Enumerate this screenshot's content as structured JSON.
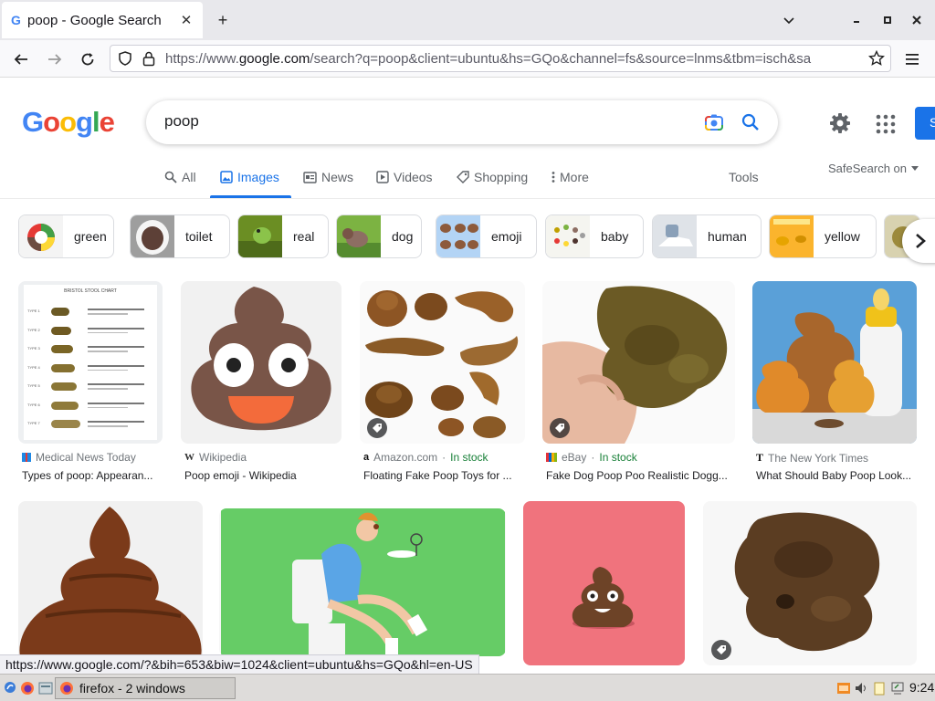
{
  "browser": {
    "tab_title": "poop - Google Search",
    "tab_favicon": "G",
    "new_tab": "+",
    "url_host_prefix": "https://www.",
    "url_host": "google.com",
    "url_path": "/search?q=poop&client=ubuntu&hs=GQo&channel=fs&source=lnms&tbm=isch&sa"
  },
  "search": {
    "query": "poop",
    "signin_label": "S"
  },
  "tabs": {
    "all": "All",
    "images": "Images",
    "news": "News",
    "videos": "Videos",
    "shopping": "Shopping",
    "more": "More",
    "tools": "Tools",
    "safesearch": "SafeSearch on"
  },
  "chips": [
    {
      "label": "green"
    },
    {
      "label": "toilet"
    },
    {
      "label": "real"
    },
    {
      "label": "dog"
    },
    {
      "label": "emoji"
    },
    {
      "label": "baby"
    },
    {
      "label": "human"
    },
    {
      "label": "yellow"
    }
  ],
  "results": [
    {
      "source": "Medical News Today",
      "stock": "",
      "caption": "Types of poop: Appearan..."
    },
    {
      "source": "Wikipedia",
      "stock": "",
      "caption": "Poop emoji - Wikipedia"
    },
    {
      "source": "Amazon.com",
      "stock": "In stock",
      "caption": "Floating Fake Poop Toys for ..."
    },
    {
      "source": "eBay",
      "stock": "In stock",
      "caption": "Fake Dog Poop Poo Realistic Dogg..."
    },
    {
      "source": "The New York Times",
      "stock": "",
      "caption": "What Should Baby Poop Look..."
    }
  ],
  "stool_chart": {
    "title": "BRISTOL STOOL CHART",
    "rows": [
      "TYPE 1",
      "TYPE 2",
      "TYPE 3",
      "TYPE 4",
      "TYPE 5",
      "TYPE 6",
      "TYPE 7"
    ]
  },
  "status_url": "https://www.google.com/?&bih=653&biw=1024&client=ubuntu&hs=GQo&hl=en-US",
  "taskbar": {
    "firefox_label": "firefox - 2 windows",
    "clock": "9:24"
  },
  "colors": {
    "google_blue": "#4285f4",
    "google_red": "#ea4335",
    "google_yellow": "#fbbc05",
    "google_green": "#34a853",
    "accent": "#1a73e8",
    "stock_green": "#188038"
  }
}
